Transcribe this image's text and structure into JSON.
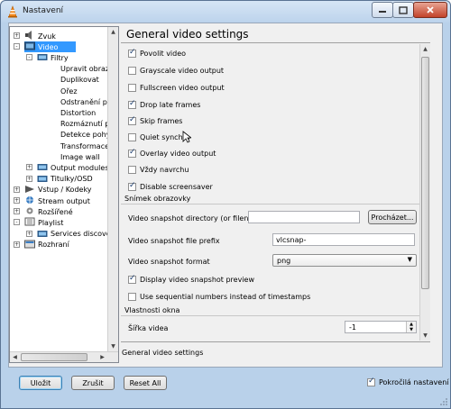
{
  "window": {
    "title": "Nastavení"
  },
  "tree": {
    "items": [
      {
        "label": "Zvuk",
        "depth": 0,
        "expander": "+",
        "selected": false,
        "icon": "audio-icon"
      },
      {
        "label": "Video",
        "depth": 0,
        "expander": "-",
        "selected": true,
        "icon": "video-icon"
      },
      {
        "label": "Filtry",
        "depth": 1,
        "expander": "-",
        "selected": false,
        "icon": "folder-icon"
      },
      {
        "label": "Upravit obraz",
        "depth": 2,
        "expander": "",
        "selected": false,
        "icon": ""
      },
      {
        "label": "Duplikovat",
        "depth": 2,
        "expander": "",
        "selected": false,
        "icon": ""
      },
      {
        "label": "Ořez",
        "depth": 2,
        "expander": "",
        "selected": false,
        "icon": ""
      },
      {
        "label": "Odstranění prok",
        "depth": 2,
        "expander": "",
        "selected": false,
        "icon": ""
      },
      {
        "label": "Distortion",
        "depth": 2,
        "expander": "",
        "selected": false,
        "icon": ""
      },
      {
        "label": "Rozmáznutí poh",
        "depth": 2,
        "expander": "",
        "selected": false,
        "icon": ""
      },
      {
        "label": "Detekce pohybu",
        "depth": 2,
        "expander": "",
        "selected": false,
        "icon": ""
      },
      {
        "label": "Transformace",
        "depth": 2,
        "expander": "",
        "selected": false,
        "icon": ""
      },
      {
        "label": "Image wall",
        "depth": 2,
        "expander": "",
        "selected": false,
        "icon": ""
      },
      {
        "label": "Output modules",
        "depth": 1,
        "expander": "+",
        "selected": false,
        "icon": "folder-icon"
      },
      {
        "label": "Titulky/OSD",
        "depth": 1,
        "expander": "+",
        "selected": false,
        "icon": "folder-icon"
      },
      {
        "label": "Vstup / Kodeky",
        "depth": 0,
        "expander": "+",
        "selected": false,
        "icon": "input-icon"
      },
      {
        "label": "Stream output",
        "depth": 0,
        "expander": "+",
        "selected": false,
        "icon": "stream-icon"
      },
      {
        "label": "Rozšířené",
        "depth": 0,
        "expander": "+",
        "selected": false,
        "icon": "advanced-icon"
      },
      {
        "label": "Playlist",
        "depth": 0,
        "expander": "-",
        "selected": false,
        "icon": "playlist-icon"
      },
      {
        "label": "Services discovery",
        "depth": 1,
        "expander": "+",
        "selected": false,
        "icon": "folder-icon"
      },
      {
        "label": "Rozhraní",
        "depth": 0,
        "expander": "+",
        "selected": false,
        "icon": "interface-icon"
      }
    ]
  },
  "panel": {
    "title": "General video settings",
    "checkboxes": [
      {
        "label": "Povolit video",
        "checked": true
      },
      {
        "label": "Grayscale video output",
        "checked": false
      },
      {
        "label": "Fullscreen video output",
        "checked": false
      },
      {
        "label": "Drop late frames",
        "checked": true
      },
      {
        "label": "Skip frames",
        "checked": true
      },
      {
        "label": "Quiet synchro",
        "checked": false
      },
      {
        "label": "Overlay video output",
        "checked": true
      },
      {
        "label": "Vždy navrchu",
        "checked": false
      },
      {
        "label": "Disable screensaver",
        "checked": true
      }
    ],
    "snapshot": {
      "section_label": "Snímek obrazovky",
      "dir_label": "Video snapshot directory (or filename)",
      "dir_value": "",
      "browse_label": "Procházet...",
      "prefix_label": "Video snapshot file prefix",
      "prefix_value": "vlcsnap-",
      "format_label": "Video snapshot format",
      "format_value": "png",
      "preview_label": "Display video snapshot preview",
      "preview_checked": true,
      "sequential_label": "Use sequential numbers instead of timestamps",
      "sequential_checked": false
    },
    "window_props": {
      "section_label": "Vlastnosti okna",
      "width_label": "Šířka videa",
      "width_value": "-1"
    }
  },
  "status_text": "General video settings",
  "footer": {
    "save_label": "Uložit",
    "cancel_label": "Zrušit",
    "reset_label": "Reset All",
    "advanced_label": "Pokročilá nastavení",
    "advanced_checked": true
  },
  "colors": {
    "selection": "#3399ff",
    "window_frame": "#b9d1ea",
    "close_button": "#c2432a"
  }
}
